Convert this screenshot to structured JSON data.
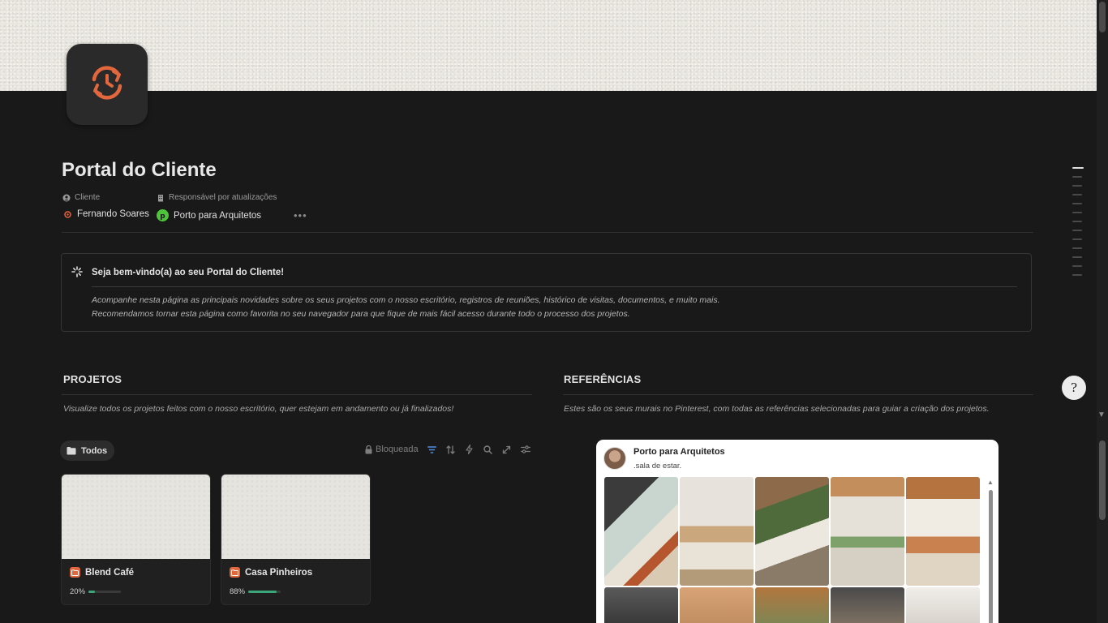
{
  "page": {
    "title": "Portal do Cliente",
    "icon": "clock-refresh-icon",
    "accent_color": "#e2673d"
  },
  "properties": [
    {
      "label": "Cliente",
      "label_icon": "person-circle-icon",
      "value": "Fernando Soares",
      "value_icon": "user-badge-icon"
    },
    {
      "label": "Responsável por atualizações",
      "label_icon": "building-icon",
      "value": "Porto para Arquitetos",
      "value_icon": "brand-logo-icon"
    }
  ],
  "callout": {
    "icon": "loading-spinner-icon",
    "title": "Seja bem-vindo(a) ao seu Portal do Cliente!",
    "line1": "Acompanhe nesta página as principais novidades sobre os seus projetos com o nosso escritório, registros de reuniões, histórico de visitas, documentos, e muito mais.",
    "line2": "Recomendamos tornar esta página como favorita no seu navegador para que fique de mais fácil acesso durante todo o processo dos projetos."
  },
  "projetos": {
    "title": "PROJETOS",
    "description": "Visualize todos os projetos feitos com o nosso escritório, quer estejam em andamento ou já finalizados!",
    "view_tab": "Todos",
    "toolbar": {
      "locked_label": "Bloqueada"
    },
    "cards": [
      {
        "title": "Blend Café",
        "progress_label": "20%",
        "progress": 0.2
      },
      {
        "title": "Casa Pinheiros",
        "progress_label": "88%",
        "progress": 0.88
      }
    ]
  },
  "referencias": {
    "title": "REFERÊNCIAS",
    "description": "Estes são os seus murais no Pinterest, com todas as referências selecionadas para guiar a criação dos projetos.",
    "widget": {
      "profile_name": "Porto para Arquitetos",
      "board_name": ".sala de estar."
    }
  },
  "help_button": {
    "label": "?"
  }
}
